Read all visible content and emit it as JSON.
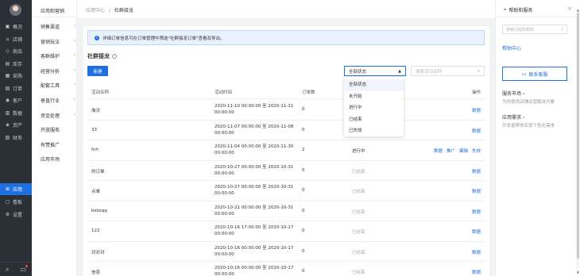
{
  "primary_nav": {
    "items": [
      {
        "icon": "home-icon",
        "glyph": "▣",
        "label": "概况"
      },
      {
        "icon": "store-icon",
        "glyph": "⌂",
        "label": "店铺"
      },
      {
        "icon": "goods-icon",
        "glyph": "◇",
        "label": "商品"
      },
      {
        "icon": "stock-icon",
        "glyph": "▤",
        "label": "库存"
      },
      {
        "icon": "purchase-icon",
        "glyph": "▦",
        "label": "采购"
      },
      {
        "icon": "order-icon",
        "glyph": "▧",
        "label": "订单"
      },
      {
        "icon": "customer-icon",
        "glyph": "◉",
        "label": "客户"
      },
      {
        "icon": "data-icon",
        "glyph": "▥",
        "label": "数据"
      },
      {
        "icon": "asset-icon",
        "glyph": "◈",
        "label": "资产"
      },
      {
        "icon": "finance-icon",
        "glyph": "▨",
        "label": "财务"
      }
    ],
    "lower_items": [
      {
        "icon": "apps-icon",
        "glyph": "⊞",
        "label": "应用",
        "active": true
      },
      {
        "icon": "board-icon",
        "glyph": "▢",
        "label": "看板"
      },
      {
        "icon": "settings-icon",
        "glyph": "⚙",
        "label": "设置"
      }
    ]
  },
  "secondary_nav": {
    "heading": "应用和营销",
    "items": [
      {
        "label": "销售渠道",
        "arrow": true
      },
      {
        "label": "营销玩法",
        "arrow": true
      },
      {
        "label": "客群维护",
        "arrow": true
      },
      {
        "label": "经营分析",
        "arrow": true
      },
      {
        "label": "配套工具",
        "arrow": true
      },
      {
        "label": "垂直行业",
        "arrow": true
      },
      {
        "label": "资金处理",
        "arrow": true
      },
      {
        "label": "开放服务",
        "arrow": false
      },
      {
        "label": "有赞推广",
        "arrow": false
      },
      {
        "label": "应用市场",
        "arrow": false
      }
    ]
  },
  "breadcrumb": {
    "parent": "应用中心",
    "separator": "/",
    "current": "社群接龙"
  },
  "notice": {
    "icon": "info-icon",
    "text": "详细订单信息可在订单管理中筛选\"社群接龙订单\"查看及导出。"
  },
  "page": {
    "title": "社群接龙",
    "new_button": "新建",
    "status_select": {
      "value": "全部状态",
      "options": [
        "全部状态",
        "未开始",
        "进行中",
        "已结束",
        "已失效"
      ]
    },
    "search_placeholder": "搜索活动名称"
  },
  "table": {
    "columns": [
      "活动名称",
      "活动时间",
      "订单数",
      "状态",
      "操作"
    ],
    "rows": [
      {
        "name": "淘沃",
        "time": "2020-11-10 00:00:00 至 2020-11-11 00:00:00",
        "orders": "0",
        "status": "",
        "ops": [
          "数据"
        ]
      },
      {
        "name": "33",
        "time": "2020-11-07 00:00:00 至 2020-11-08 00:00:00",
        "orders": "0",
        "status": "",
        "ops": [
          "数据"
        ]
      },
      {
        "name": "fnh",
        "time": "2020-11-04 00:00:00 至 2020-11-30 00:00:00",
        "orders": "2",
        "status": "进行中",
        "ops": [
          "数据",
          "推广",
          "编辑",
          "失效"
        ]
      },
      {
        "name": "的订单",
        "time": "2020-10-27 00:00:00 至 2020-10-31 00:00:00",
        "orders": "0",
        "status": "已结束",
        "ops": [
          "数据"
        ]
      },
      {
        "name": "点单",
        "time": "2020-10-27 00:00:00 至 2020-10-31 00:00:00",
        "orders": "0",
        "status": "已结束",
        "ops": [
          "数据"
        ]
      },
      {
        "name": "bsbsqq",
        "time": "2020-10-21 00:00:00 至 2020-10-31 00:00:00",
        "orders": "0",
        "status": "已结束",
        "ops": [
          "数据"
        ]
      },
      {
        "name": "122",
        "time": "2020-10-16 17:00:00 至 2020-10-17 00:00:00",
        "orders": "0",
        "status": "已结束",
        "ops": [
          "数据"
        ]
      },
      {
        "name": "对对对",
        "time": "2020-10-16 00:00:00 至 2020-10-17 00:00:00",
        "orders": "0",
        "status": "已结束",
        "ops": [
          "数据"
        ]
      },
      {
        "name": "信息",
        "time": "2020-10-16 00:00:00 至 2020-10-17 00:00:00",
        "orders": "0",
        "status": "已结束",
        "ops": [
          "数据"
        ]
      }
    ]
  },
  "help": {
    "title": "帮助和服务",
    "search_placeholder": "搜索问题和帮助",
    "help_center": "帮助中心",
    "contact_button": "联系客服",
    "market_title": "服务市场 ›",
    "market_desc": "为你提供店铺运营解决方案",
    "demand_title": "应用需求 ›",
    "demand_desc": "开发者帮你实现个性化需求"
  },
  "colors": {
    "accent": "#1e6fe0",
    "sidebar": "#2b2f36",
    "notice_bg": "#e8f1fd"
  }
}
